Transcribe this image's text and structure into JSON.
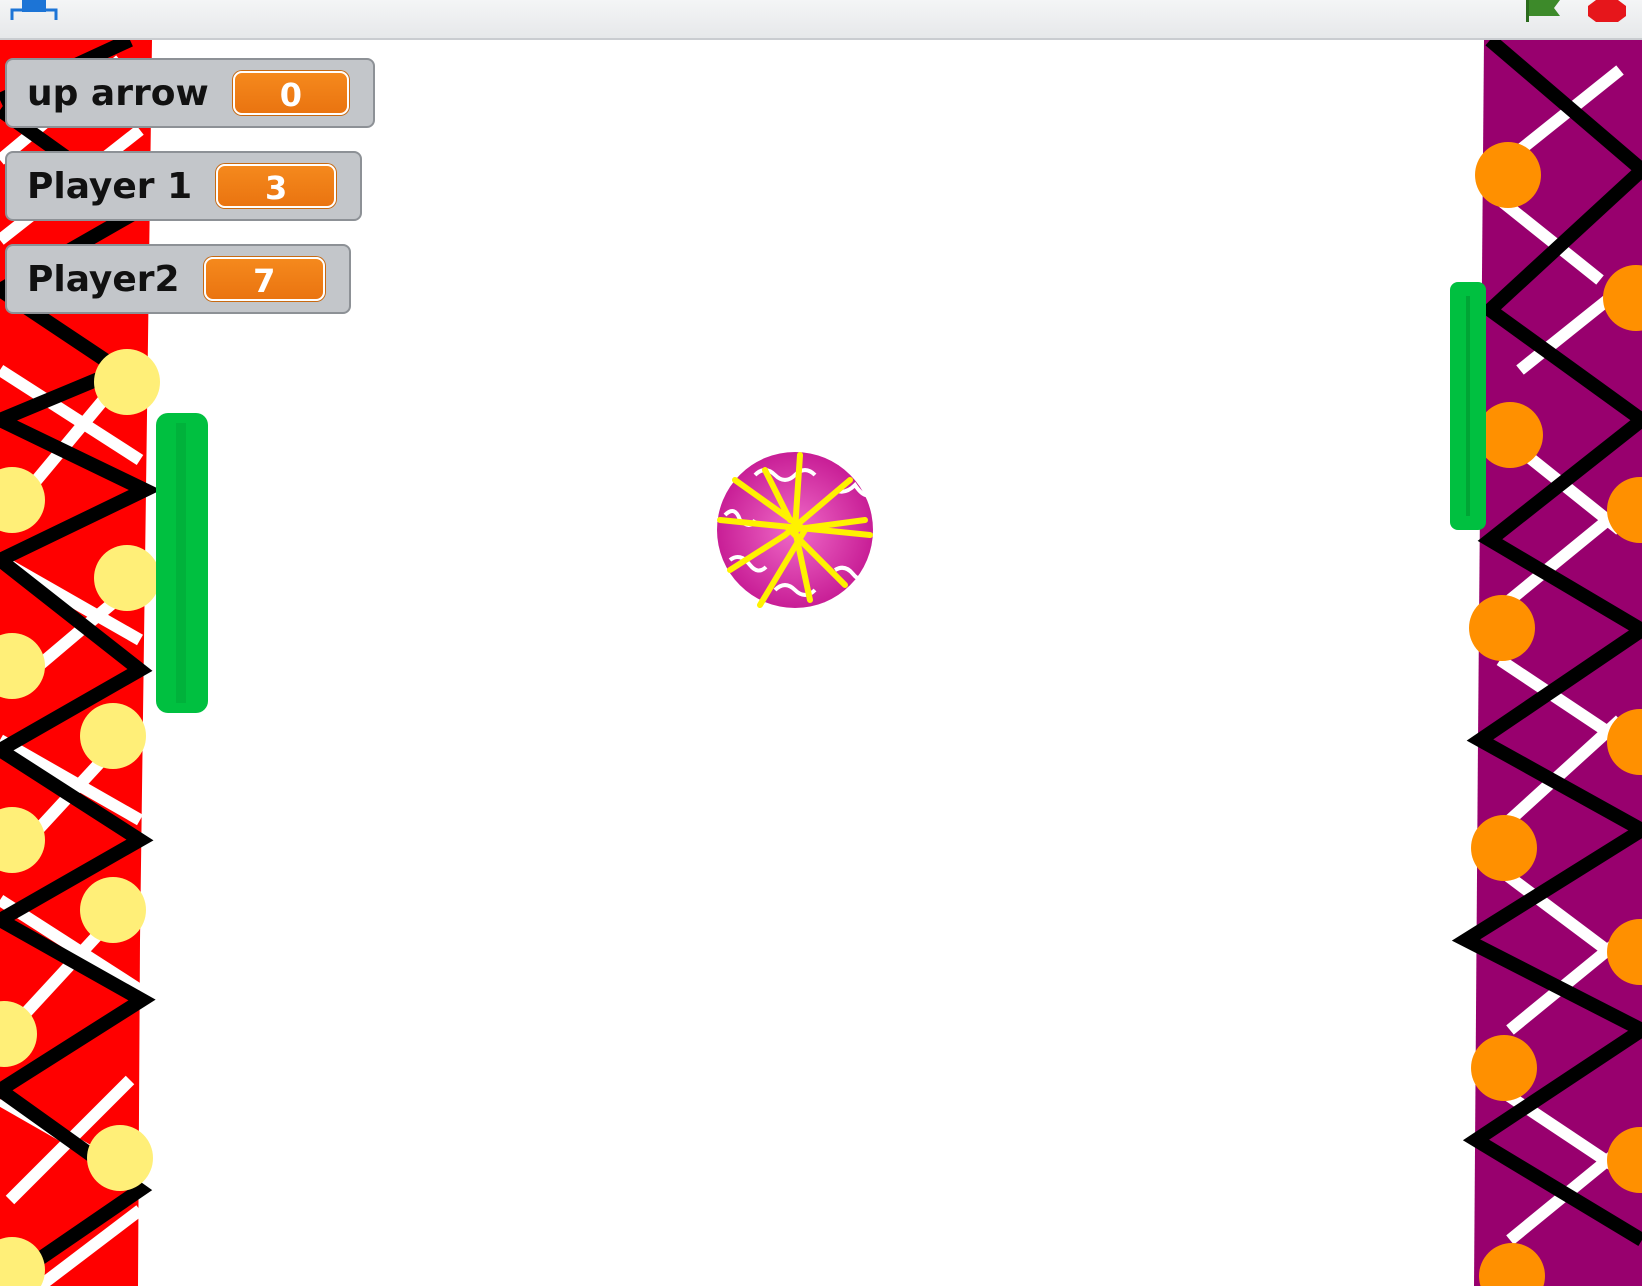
{
  "toolbar": {
    "fullscreen_icon": "fullscreen-icon",
    "green_flag_icon": "green-flag-icon",
    "stop_icon": "stop-sign-icon"
  },
  "monitors": [
    {
      "label": "up arrow",
      "value": "0"
    },
    {
      "label": "Player 1",
      "value": "3"
    },
    {
      "label": "Player2",
      "value": "7"
    }
  ],
  "colors": {
    "left_wall": "#ff0000",
    "right_wall": "#98006e",
    "paddle": "#00c040",
    "ball": "#e040b0",
    "monitor_value": "#f07f16",
    "left_dots": "#ffef78",
    "right_dots": "#ff9000"
  }
}
